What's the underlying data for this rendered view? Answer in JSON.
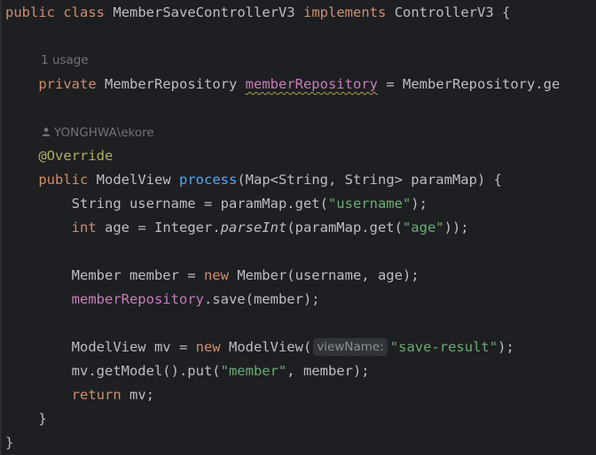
{
  "editor": {
    "line1": {
      "kw_public": "public",
      "kw_class": "class",
      "class_name": "MemberSaveControllerV3",
      "kw_implements": "implements",
      "iface": "ControllerV3",
      "brace": "{"
    },
    "usage_hint": "1 usage",
    "field_line": {
      "kw_private": "private",
      "type": "MemberRepository",
      "name": "memberRepository",
      "assign": "=",
      "rhs": "MemberRepository.ge"
    },
    "author_hint": "YONGHWA\\ekore",
    "annotation": "@Override",
    "method_line": {
      "kw_public": "public",
      "ret": "ModelView",
      "name": "process",
      "params": "(Map<String, String> paramMap) {"
    },
    "username_line": {
      "pre": "String username = paramMap.get(",
      "str": "\"username\"",
      "post": ");"
    },
    "age_line": {
      "kw_int": "int",
      "pre": "age = Integer.",
      "fn": "parseInt",
      "mid": "(paramMap.get(",
      "str": "\"age\"",
      "post": "));"
    },
    "member_line": {
      "pre": "Member member = ",
      "kw_new": "new",
      "post": "Member(username, age);"
    },
    "save_line": {
      "field": "memberRepository",
      "post": ".save(member);"
    },
    "mv_line": {
      "pre": "ModelView mv = ",
      "kw_new": "new",
      "post": "ModelView(",
      "inlay": "viewName:",
      "str": "\"save-result\"",
      "end": ");"
    },
    "put_line": {
      "pre": "mv.getModel().put(",
      "str": "\"member\"",
      "post": ", member);"
    },
    "return_line": {
      "kw_return": "return",
      "post": "mv;"
    },
    "method_close": "}",
    "class_close": "}"
  },
  "colors": {
    "background": "#1e1f22",
    "keyword": "#cf8e6d",
    "string": "#6aab73",
    "method": "#56a8f5",
    "field": "#c77dbb",
    "annotation": "#b3ae60",
    "text": "#bcbec4",
    "hint": "#6f737a"
  }
}
